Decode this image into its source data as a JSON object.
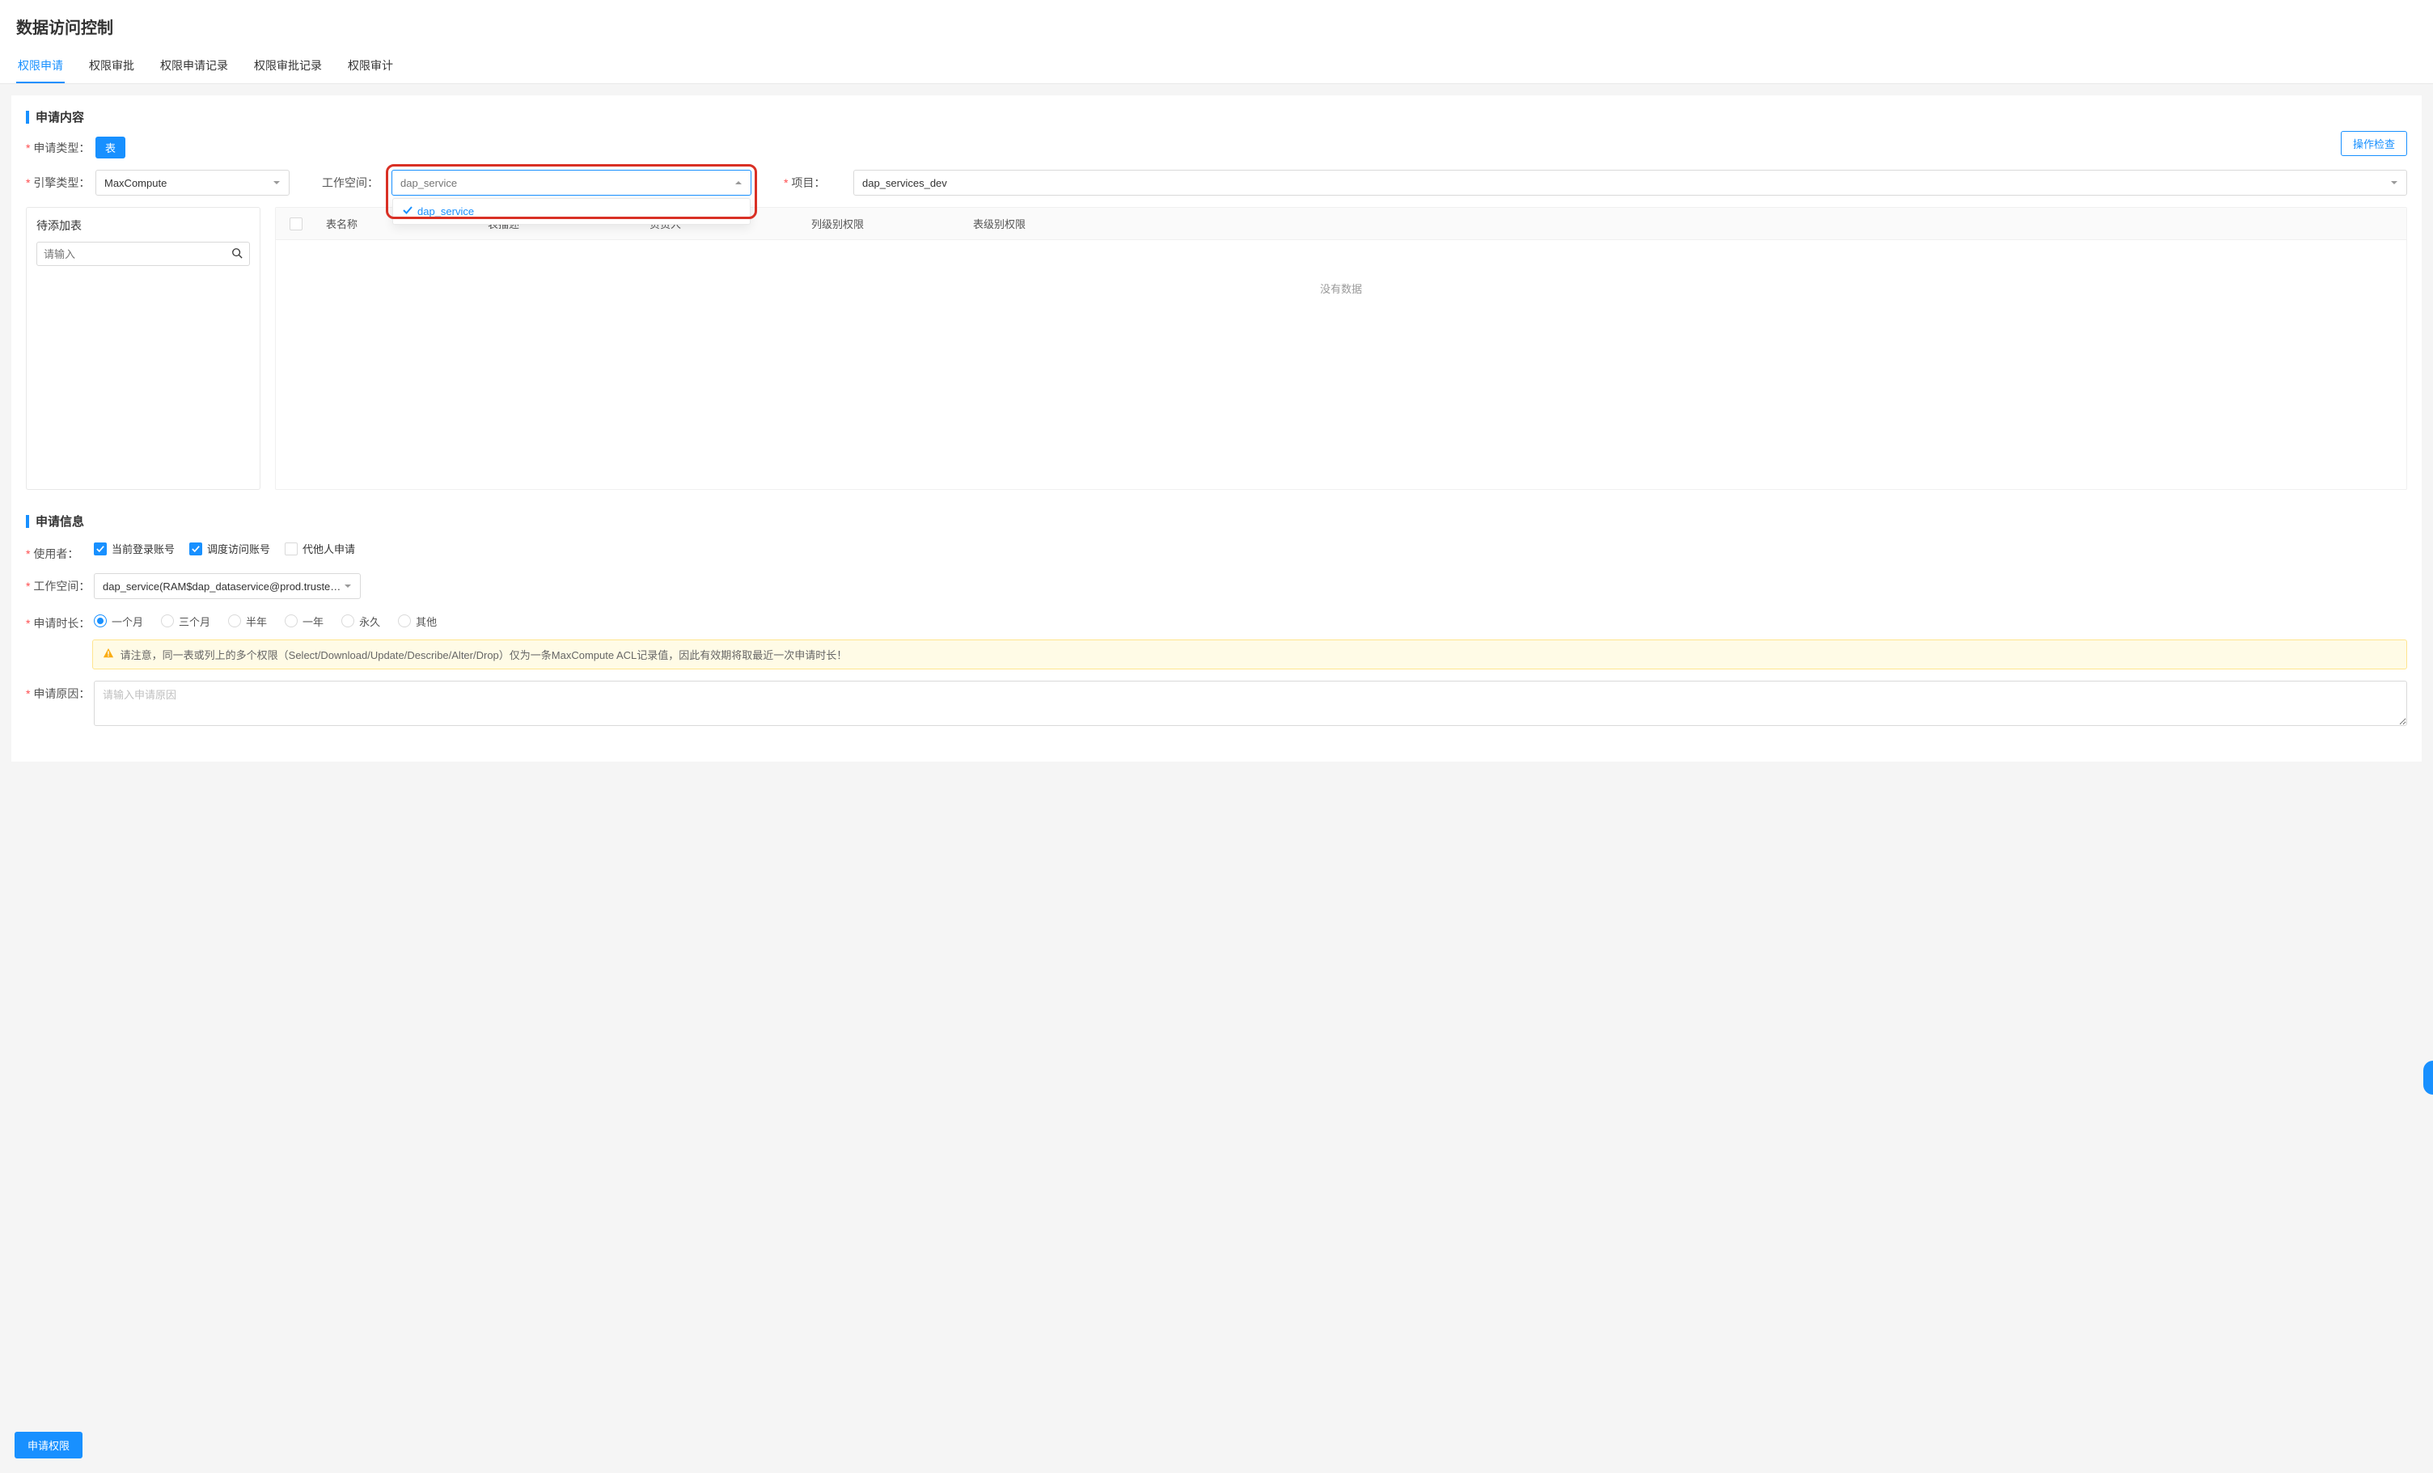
{
  "page_title": "数据访问控制",
  "tabs": [
    "权限申请",
    "权限审批",
    "权限申请记录",
    "权限审批记录",
    "权限审计"
  ],
  "active_tab_index": 0,
  "section_apply_content": "申请内容",
  "labels": {
    "apply_type": "申请类型：",
    "engine_type": "引擎类型：",
    "workspace": "工作空间：",
    "project": "项目："
  },
  "apply_type_value": "表",
  "engine_type_value": "MaxCompute",
  "workspace_placeholder": "dap_service",
  "workspace_dropdown_option": "dap_service",
  "project_value": "dap_services_dev",
  "op_check_btn": "操作检查",
  "left_panel_title": "待添加表",
  "left_panel_search_placeholder": "请输入",
  "table_headers": {
    "name": "表名称",
    "desc": "表描述",
    "owner": "负责人",
    "col_perm": "列级别权限",
    "tbl_perm": "表级别权限"
  },
  "table_empty": "没有数据",
  "section_apply_info": "申请信息",
  "info_labels": {
    "user": "使用者：",
    "workspace": "工作空间：",
    "duration": "申请时长：",
    "reason": "申请原因："
  },
  "user_checkboxes": {
    "current_login": "当前登录账号",
    "schedule_access": "调度访问账号",
    "proxy_apply": "代他人申请"
  },
  "info_workspace_value": "dap_service(RAM$dap_dataservice@prod.trusteeship....",
  "duration_options": [
    "一个月",
    "三个月",
    "半年",
    "一年",
    "永久",
    "其他"
  ],
  "duration_selected_index": 0,
  "alert_text": "请注意，同一表或列上的多个权限（Select/Download/Update/Describe/Alter/Drop）仅为一条MaxCompute ACL记录值，因此有效期将取最近一次申请时长！",
  "reason_placeholder": "请输入申请原因",
  "footer_btn": "申请权限"
}
